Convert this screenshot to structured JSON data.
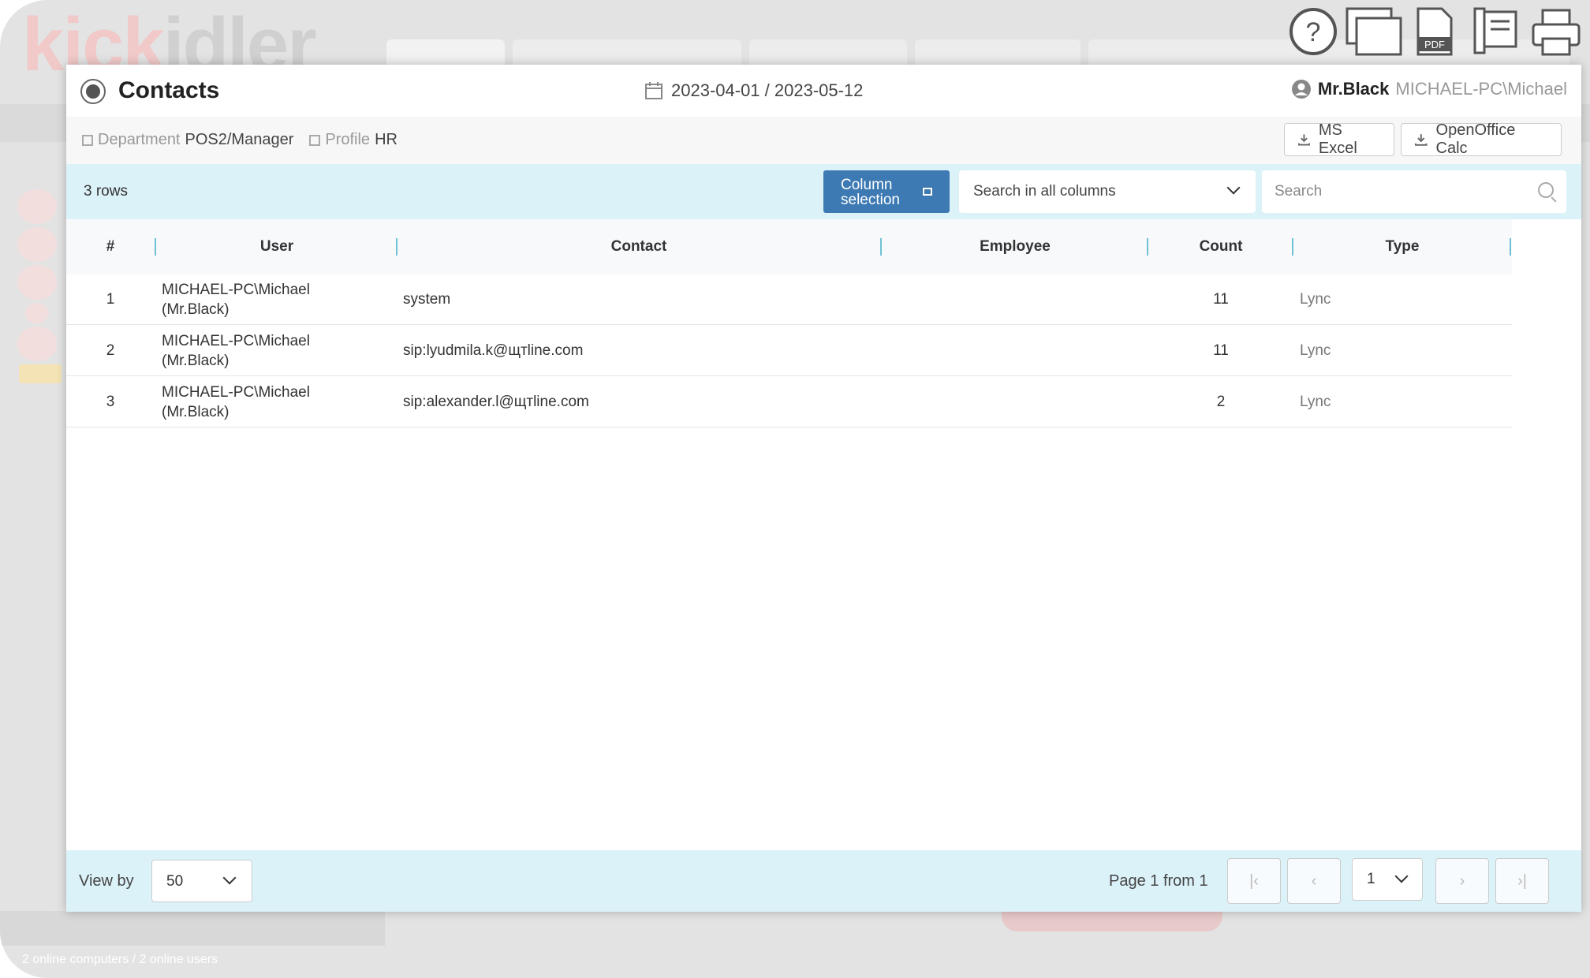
{
  "background": {
    "logo_k": "kick",
    "logo_rest": "idler",
    "status": "2 online computers / 2 online users"
  },
  "toolbar": {
    "icons": [
      "help-icon",
      "windows-icon",
      "pdf-icon",
      "archive-icon",
      "print-icon"
    ],
    "pdf_label": "PDF"
  },
  "modal": {
    "title": "Contacts",
    "date_range": "2023-04-01 / 2023-05-12",
    "user_name": "Mr.Black",
    "user_pc": "MICHAEL-PC\\Michael",
    "department_label": "Department",
    "department_value": "POS2/Manager",
    "profile_label": "Profile",
    "profile_value": "HR",
    "export_excel": "MS Excel",
    "export_calc": "OpenOffice Calc"
  },
  "bar": {
    "rows": "3 rows",
    "column_selection": [
      "Column",
      "selection"
    ],
    "search_scope": "Search in all columns",
    "search_placeholder": "Search"
  },
  "table": {
    "columns": [
      "#",
      "User",
      "Contact",
      "Employee",
      "Count",
      "Type"
    ],
    "rows": [
      {
        "num": "1",
        "user_line1": "MICHAEL-PC\\Michael",
        "user_line2": "(Mr.Black)",
        "contact": "system",
        "employee": "",
        "count": "11",
        "type": "Lync"
      },
      {
        "num": "2",
        "user_line1": "MICHAEL-PC\\Michael",
        "user_line2": "(Mr.Black)",
        "contact": "sip:lyudmila.k@щтline.com",
        "employee": "",
        "count": "11",
        "type": "Lync"
      },
      {
        "num": "3",
        "user_line1": "MICHAEL-PC\\Michael",
        "user_line2": "(Mr.Black)",
        "contact": "sip:alexander.l@щтline.com",
        "employee": "",
        "count": "2",
        "type": "Lync"
      }
    ]
  },
  "footer": {
    "view_by_label": "View by",
    "view_by_value": "50",
    "page_info": "Page 1 from 1",
    "page_value": "1",
    "first": "|‹",
    "prev": "‹",
    "next": "›",
    "last": "›|"
  }
}
